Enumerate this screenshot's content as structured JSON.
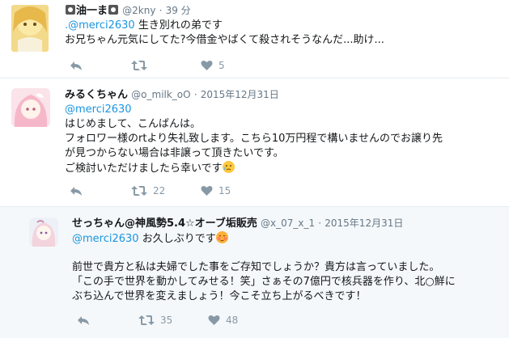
{
  "colors": {
    "accent": "#1b95e0",
    "secondary": "#657786",
    "icon": "#8899a6",
    "divider": "#e6ecf0",
    "highlight": "#f5f8fa"
  },
  "tweets": [
    {
      "name": "油一ま",
      "handle": "@2kny",
      "time": "39 分",
      "mention": "@merci2630",
      "lines": [
        "生き別れの弟です",
        "お兄ちゃん元気にしてた?今借金やばくて殺されそうなんだ...助け..."
      ],
      "reply_label": "",
      "retweet_count": "",
      "like_count": "5"
    },
    {
      "name": "みるくちゃん",
      "handle": "@o_milk_oO",
      "time": "2015年12月31日",
      "mention": "@merci2630",
      "lines": [
        "はじめまして、こんばんは。",
        "フォロワー様のrtより失礼致します。こちら10万円程で構いませんのでお譲り先",
        "が見つからない場合は非譲って頂きたいです。",
        "ご検討いただけましたら幸いです"
      ],
      "retweet_count": "22",
      "like_count": "15"
    },
    {
      "name": "せっちゃん@神風勢5.4☆オーブ垢販売",
      "handle": "@x_07_x_1",
      "time": "2015年12月31日",
      "mention": "@merci2630",
      "mention_suffix": "お久しぶりです",
      "lines": [
        "前世で貴方と私は夫婦でした事をご存知でしょうか？貴方は言っていました。",
        "「この手で世界を動かしてみせる！笑」さぁその7億円で核兵器を作り、北○鮮に",
        "ぶち込んで世界を変えましょう！今こそ立ち上がるべきです！"
      ],
      "retweet_count": "35",
      "like_count": "48"
    }
  ]
}
